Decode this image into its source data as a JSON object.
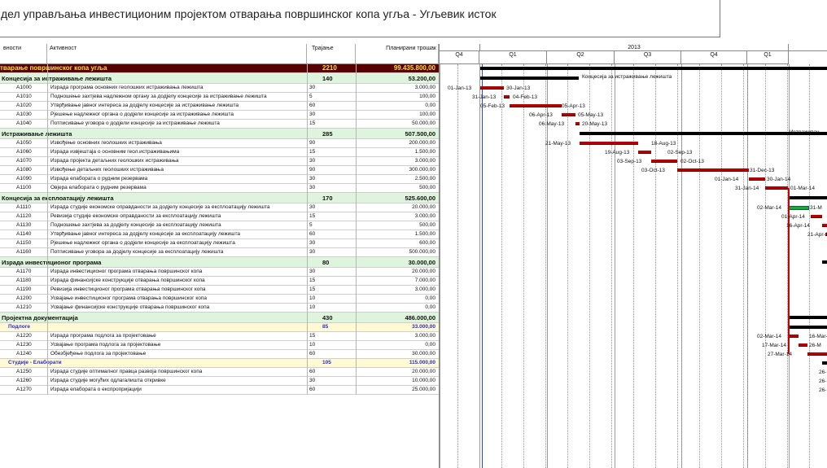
{
  "title": "дел управљања инвестиционим пројектом отварања површинског копа угља - Угљевик исток",
  "columns": {
    "id": "вности",
    "activity": "Активност",
    "duration": "Трајање",
    "cost": "Планирани трошак"
  },
  "timeline": {
    "year": "2013",
    "quarters": [
      "Q4",
      "Q1",
      "Q2",
      "Q3",
      "Q4",
      "Q1"
    ]
  },
  "rows": [
    {
      "kind": "top",
      "id": "",
      "name": "тварање површинског копа угља",
      "dur": "2210",
      "cost": "99.435.800,00"
    },
    {
      "kind": "sum",
      "id": "",
      "name": "Концесија за истраживање лежишта",
      "dur": "140",
      "cost": "53.200,00"
    },
    {
      "kind": "task",
      "id": "A1000",
      "name": "Израда програма основних геолошких истраживања лежишта",
      "dur": "30",
      "cost": "3.000,00"
    },
    {
      "kind": "task",
      "id": "A1010",
      "name": "Подношење захтјева надлежном органу за додјелу концесије за истраживање лежишта",
      "dur": "5",
      "cost": "100,00"
    },
    {
      "kind": "task",
      "id": "A1020",
      "name": "Утврђивање јавног интереса за додјелу концесије за истраживање лежишта",
      "dur": "60",
      "cost": "0,00"
    },
    {
      "kind": "task",
      "id": "A1030",
      "name": "Рјешење надлежног органа о додјели концесије за истраживање лежишта",
      "dur": "30",
      "cost": "100,00"
    },
    {
      "kind": "task",
      "id": "A1040",
      "name": "Потписивање уговора о додјели концесије за истраживање лежишта",
      "dur": "15",
      "cost": "50.000,00"
    },
    {
      "kind": "sum",
      "id": "",
      "name": "Истраживање лежишта",
      "dur": "285",
      "cost": "507.500,00"
    },
    {
      "kind": "task",
      "id": "A1050",
      "name": "Извођење основних геолошких истраживања",
      "dur": "90",
      "cost": "200.000,00"
    },
    {
      "kind": "task",
      "id": "A1060",
      "name": "Израда извјештаја о основним геол.истраживањима",
      "dur": "15",
      "cost": "1.500,00"
    },
    {
      "kind": "task",
      "id": "A1070",
      "name": "Израда пројекта детаљних геолошких истраживања",
      "dur": "30",
      "cost": "3.000,00"
    },
    {
      "kind": "task",
      "id": "A1080",
      "name": "Извођење детаљних геолошких истраживања",
      "dur": "90",
      "cost": "300.000,00"
    },
    {
      "kind": "task",
      "id": "A1090",
      "name": "Израда елабората о рудним резервама",
      "dur": "30",
      "cost": "2.500,00"
    },
    {
      "kind": "task",
      "id": "A1100",
      "name": "Овјера елабората о рудним резервама",
      "dur": "30",
      "cost": "500,00"
    },
    {
      "kind": "sum",
      "id": "",
      "name": "Концесија за експлоатацију лежишта",
      "dur": "170",
      "cost": "525.600,00"
    },
    {
      "kind": "task",
      "id": "A1110",
      "name": "Израда студије економске оправданости за додјелу концесије за експлоатацију лежишта",
      "dur": "30",
      "cost": "20.000,00"
    },
    {
      "kind": "task",
      "id": "A1120",
      "name": "Ревизија студије економске оправданости за експлоатацију лежишта",
      "dur": "15",
      "cost": "3.000,00"
    },
    {
      "kind": "task",
      "id": "A1130",
      "name": "Подношење захтјева за додјелу концесије за експлоатацију лежишта",
      "dur": "5",
      "cost": "500,00"
    },
    {
      "kind": "task",
      "id": "A1140",
      "name": "Утврђивање јавног интереса за додјелу концесије за експлоатацију лежишта",
      "dur": "60",
      "cost": "1.500,00"
    },
    {
      "kind": "task",
      "id": "A1150",
      "name": "Рјешење надлежног органа о додјели концесије за експлоатацију лежишта",
      "dur": "30",
      "cost": "600,00"
    },
    {
      "kind": "task",
      "id": "A1160",
      "name": "Потписивање уговора за додјелу концесије за експлоатацију лежишта",
      "dur": "30",
      "cost": "500.000,00"
    },
    {
      "kind": "sum",
      "id": "",
      "name": "Израда инвестиционог програма",
      "dur": "80",
      "cost": "30.000,00"
    },
    {
      "kind": "task",
      "id": "A1170",
      "name": "Израда инвестиционог програма отварања површинског копа",
      "dur": "30",
      "cost": "20.000,00"
    },
    {
      "kind": "task",
      "id": "A1180",
      "name": "Израда финансијске конструкције отварања површинског копа",
      "dur": "15",
      "cost": "7.000,00"
    },
    {
      "kind": "task",
      "id": "A1190",
      "name": "Ревизија инвестиционог програма отварања површинског копа",
      "dur": "15",
      "cost": "3.000,00"
    },
    {
      "kind": "task",
      "id": "A1200",
      "name": "Усвајање инвестиционог програма отварања површинског копа",
      "dur": "10",
      "cost": "0,00"
    },
    {
      "kind": "task",
      "id": "A1210",
      "name": "Усвајање финансијске конструкције отварања површинског копа",
      "dur": "10",
      "cost": "0,00"
    },
    {
      "kind": "sum",
      "id": "",
      "name": "Пројектна документација",
      "dur": "430",
      "cost": "486.000,00"
    },
    {
      "kind": "sub",
      "id": "",
      "name": "Подлоге",
      "dur": "85",
      "cost": "33.000,00"
    },
    {
      "kind": "task",
      "id": "A1220",
      "name": "Израда програма подлога за пројектовање",
      "dur": "15",
      "cost": "3.000,00"
    },
    {
      "kind": "task",
      "id": "A1230",
      "name": "Усвајање програма подлога за пројектовање",
      "dur": "10",
      "cost": "0,00"
    },
    {
      "kind": "task",
      "id": "A1240",
      "name": "Обезбјеђење подлога за пројектовање",
      "dur": "60",
      "cost": "30.000,00"
    },
    {
      "kind": "sub",
      "id": "",
      "name": "Студије - Елаборати",
      "dur": "105",
      "cost": "115.000,00"
    },
    {
      "kind": "task",
      "id": "A1250",
      "name": "Израда студије оптималног правца развоја површинског копа",
      "dur": "60",
      "cost": "20.000,00"
    },
    {
      "kind": "task",
      "id": "A1260",
      "name": "Израда студије могућих одлагалишта откривке",
      "dur": "30",
      "cost": "10.000,00"
    },
    {
      "kind": "task",
      "id": "A1270",
      "name": "Израда елабората о експропријацији",
      "dur": "60",
      "cost": "25.000,00"
    }
  ],
  "gantt_labels": [
    {
      "row": 1,
      "t": "Концесија за истраживање лежишта"
    },
    {
      "row": 7,
      "t": "Истраживањ"
    },
    {
      "row": 2,
      "t": "01-Jan-13"
    },
    {
      "row": 2,
      "t": "30-Jan-13"
    },
    {
      "row": 3,
      "t": "31-Jan-13"
    },
    {
      "row": 3,
      "t": "04-Feb-13"
    },
    {
      "row": 4,
      "t": "05-Feb-13"
    },
    {
      "row": 4,
      "t": "05-Apr-13"
    },
    {
      "row": 5,
      "t": "06-Apr-13"
    },
    {
      "row": 5,
      "t": "05-May-13"
    },
    {
      "row": 6,
      "t": "06-May-13"
    },
    {
      "row": 6,
      "t": "20-May-13"
    },
    {
      "row": 8,
      "t": "21-May-13"
    },
    {
      "row": 8,
      "t": "18-Aug-13"
    },
    {
      "row": 9,
      "t": "19-Aug-13"
    },
    {
      "row": 9,
      "t": "02-Sep-13"
    },
    {
      "row": 10,
      "t": "03-Sep-13"
    },
    {
      "row": 10,
      "t": "02-Oct-13"
    },
    {
      "row": 11,
      "t": "03-Oct-13"
    },
    {
      "row": 11,
      "t": "31-Dec-13"
    },
    {
      "row": 12,
      "t": "01-Jan-14"
    },
    {
      "row": 12,
      "t": "30-Jan-14"
    },
    {
      "row": 13,
      "t": "31-Jan-14"
    },
    {
      "row": 13,
      "t": "01-Mar-14"
    },
    {
      "row": 15,
      "t": "02-Mar-14"
    },
    {
      "row": 15,
      "t": "31-M"
    },
    {
      "row": 16,
      "t": "01-Apr-14"
    },
    {
      "row": 17,
      "t": "16-Apr-14"
    },
    {
      "row": 18,
      "t": "21-Apr-14"
    },
    {
      "row": 29,
      "t": "02-Mar-14"
    },
    {
      "row": 29,
      "t": "16-Mar-"
    },
    {
      "row": 30,
      "t": "17-Mar-14"
    },
    {
      "row": 30,
      "t": "26-M"
    },
    {
      "row": 31,
      "t": "27-Mar-14"
    },
    {
      "row": 33,
      "t": "26-"
    },
    {
      "row": 34,
      "t": "26-"
    },
    {
      "row": 35,
      "t": "26-"
    }
  ],
  "colors": {
    "bar": "#b80000",
    "summary": "#000000",
    "green": "#1eaa2a",
    "today": "#2246d6",
    "top_bg": "#5a0000",
    "top_fg": "#ffde33"
  }
}
